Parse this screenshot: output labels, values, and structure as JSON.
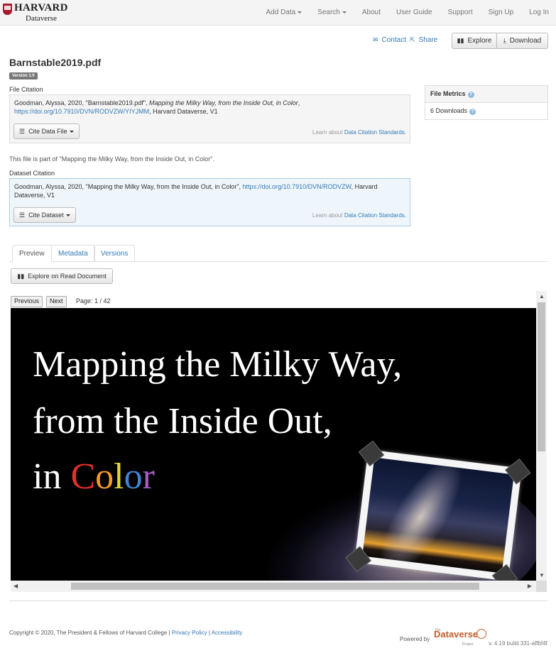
{
  "brand": {
    "name": "HARVARD",
    "sub": "Dataverse"
  },
  "nav": {
    "add_data": "Add Data",
    "search": "Search",
    "about": "About",
    "user_guide": "User Guide",
    "support": "Support",
    "sign_up": "Sign Up",
    "log_in": "Log In"
  },
  "actions": {
    "contact": "Contact",
    "share": "Share",
    "explore": "Explore",
    "download": "Download"
  },
  "file": {
    "title": "Barnstable2019.pdf",
    "version": "Version 1.0",
    "citation_label": "File Citation",
    "citation_pre": "Goodman, Alyssa, 2020, \"Barnstable2019.pdf\", ",
    "citation_italic": "Mapping the Milky Way, from the Inside Out, in Color",
    "citation_comma": ",",
    "citation_link": "https://doi.org/10.7910/DVN/RODVZW/YIYJMM",
    "citation_post": ", Harvard Dataverse, V1",
    "cite_button": "Cite Data File",
    "learn_pre": "Learn about ",
    "learn_link": "Data Citation Standards."
  },
  "part_of": "This file is part of \"Mapping the Milky Way, from the Inside Out, in Color\".",
  "dataset": {
    "citation_label": "Dataset Citation",
    "citation_pre": "Goodman, Alyssa, 2020, \"Mapping the Milky Way, from the Inside Out, in Color\", ",
    "citation_link": "https://doi.org/10.7910/DVN/RODVZW",
    "citation_post": ", Harvard Dataverse, V1",
    "cite_button": "Cite Dataset",
    "learn_pre": "Learn about ",
    "learn_link": "Data Citation Standards."
  },
  "metrics": {
    "title": "File Metrics",
    "downloads": "6 Downloads"
  },
  "tabs": [
    {
      "label": "Preview"
    },
    {
      "label": "Metadata"
    },
    {
      "label": "Versions"
    }
  ],
  "preview": {
    "explore_button": "Explore on Read Document",
    "previous": "Previous",
    "next": "Next",
    "page": "Page: 1 / 42",
    "slide_line1": "Mapping the Milky Way,",
    "slide_line2": "from the Inside Out,",
    "slide_line3_pre": "in ",
    "color_letters": [
      "C",
      "o",
      "l",
      "o",
      "r"
    ]
  },
  "footer": {
    "copyright": "Copyright © 2020, The President & Fellows of Harvard College | ",
    "privacy": "Privacy Policy",
    "sep": " | ",
    "accessibility": "Accessibility",
    "powered_by": "Powered by",
    "logo_the": "The",
    "logo": "Dataverse",
    "logo_project": "Project",
    "build": "v. 4.19 build 331-affbf4f"
  }
}
